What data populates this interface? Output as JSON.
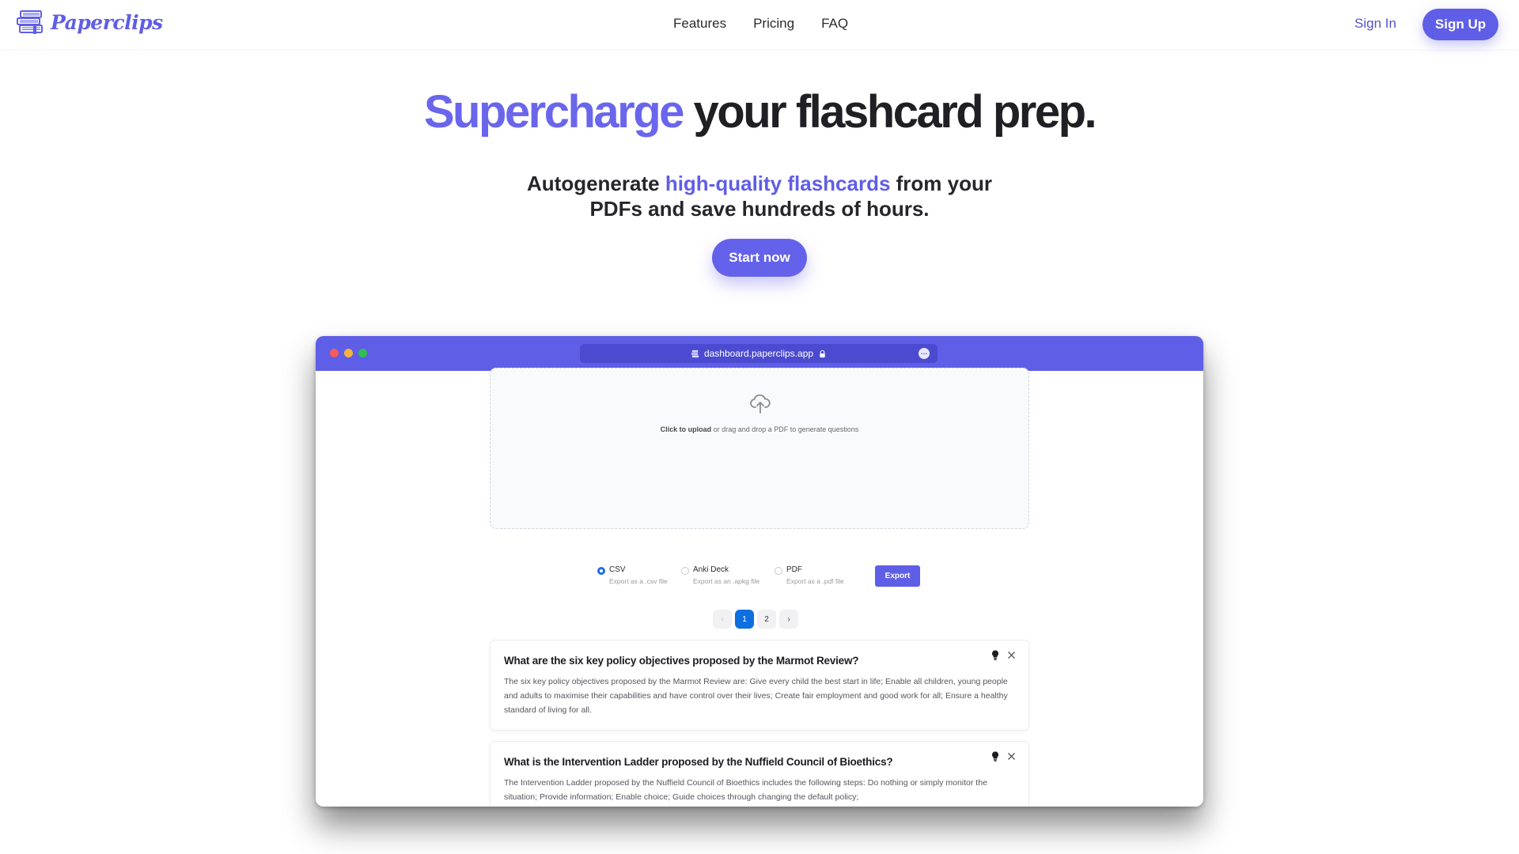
{
  "nav": {
    "brand": "Paperclips",
    "links": [
      {
        "label": "Features"
      },
      {
        "label": "Pricing"
      },
      {
        "label": "FAQ"
      }
    ],
    "sign_in": "Sign In",
    "sign_up": "Sign Up"
  },
  "hero": {
    "title_accent": "Supercharge",
    "title_rest": " your flashcard prep.",
    "subtitle_pre": "Autogenerate ",
    "subtitle_accent": "high-quality flashcards",
    "subtitle_post_line1": " from your",
    "subtitle_line2": "PDFs and save hundreds of hours.",
    "cta": "Start now"
  },
  "browser": {
    "url": "dashboard.paperclips.app",
    "more_icon": "…",
    "upload": {
      "bold": "Click to upload",
      "rest": " or drag and drop a PDF to generate questions"
    },
    "export_options": [
      {
        "label": "CSV",
        "desc": "Export as a .csv file",
        "checked": true
      },
      {
        "label": "Anki Deck",
        "desc": "Export as an .apkg file",
        "checked": false
      },
      {
        "label": "PDF",
        "desc": "Export as a .pdf file",
        "checked": false
      }
    ],
    "export_button": "Export",
    "pagination": {
      "prev": "‹",
      "pages": [
        "1",
        "2"
      ],
      "current": "1",
      "next": "›"
    },
    "cards": [
      {
        "question": "What are the six key policy objectives proposed by the Marmot Review?",
        "answer": "The six key policy objectives proposed by the Marmot Review are: Give every child the best start in life; Enable all children, young people and adults to maximise their capabilities and have control over their lives; Create fair employment and good work for all; Ensure a healthy standard of living for all."
      },
      {
        "question": "What is the Intervention Ladder proposed by the Nuffield Council of Bioethics?",
        "answer": "The Intervention Ladder proposed by the Nuffield Council of Bioethics includes the following steps: Do nothing or simply monitor the situation; Provide information; Enable choice; Guide choices through changing the default policy;"
      }
    ]
  },
  "colors": {
    "brand": "#5f5ee6",
    "accent_light": "#6a66ec",
    "active_page": "#0d6fe0",
    "text_dark": "#1f1f24"
  }
}
